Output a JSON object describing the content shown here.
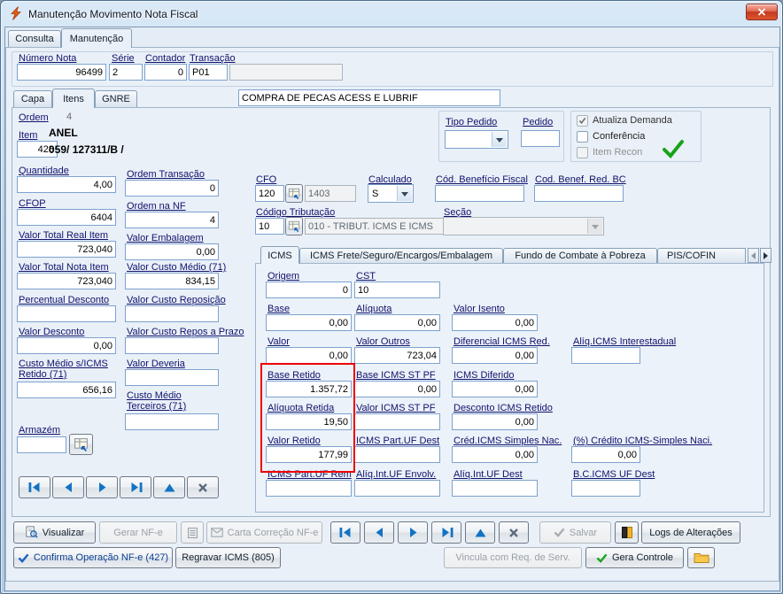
{
  "window": {
    "title": "Manutenção Movimento Nota Fiscal"
  },
  "main_tabs": {
    "consulta": "Consulta",
    "manutencao": "Manutenção"
  },
  "header": {
    "numero_label": "Número Nota",
    "numero": "96499",
    "serie_label": "Série",
    "serie": "2",
    "contador_label": "Contador",
    "contador": "0",
    "transacao_label": "Transação",
    "transacao": "P01",
    "transacao_extra": ""
  },
  "page_tabs": {
    "capa": "Capa",
    "itens": "Itens",
    "gnre": "GNRE"
  },
  "descricao": "COMPRA DE PECAS ACESS E LUBRIF",
  "item": {
    "ordem_label": "Ordem",
    "ordem": "4",
    "item_label": "Item",
    "codigo": "428",
    "nome": "ANEL",
    "referencia": "059/ 127311/B /",
    "tipo_pedido_label": "Tipo Pedido",
    "tipo_pedido": "",
    "pedido_label": "Pedido",
    "pedido": "",
    "atualiza_demanda_label": "Atualiza Demanda",
    "conferencia_label": "Conferência",
    "item_recon_label": "Item Recon"
  },
  "col1": [
    {
      "label": "Quantidade",
      "value": "4,00"
    },
    {
      "label": "CFOP",
      "value": "6404"
    },
    {
      "label": "Valor Total Real Item",
      "value": "723,040"
    },
    {
      "label": "Valor Total Nota Item",
      "value": "723,040"
    },
    {
      "label": "Percentual Desconto",
      "value": ""
    },
    {
      "label": "Valor Desconto",
      "value": "0,00"
    },
    {
      "label_l1": "Custo Médio s/ICMS",
      "label_l2": "Retido (71)",
      "value": "656,16"
    }
  ],
  "armazem": {
    "label": "Armazém",
    "value": ""
  },
  "col2": [
    {
      "label": "Ordem Transação",
      "value": "0"
    },
    {
      "label": "Ordem na NF",
      "value": "4"
    },
    {
      "label": "Valor Embalagem",
      "value": "0,00"
    },
    {
      "label": "Valor Custo Médio (71)",
      "value": "834,15"
    },
    {
      "label": "Valor Custo Reposição",
      "value": ""
    },
    {
      "label": "Valor Custo Repos a Prazo",
      "value": ""
    },
    {
      "label": "Valor Deveria",
      "value": ""
    },
    {
      "label_l1": "Custo Médio",
      "label_l2": "Terceiros (71)",
      "value": ""
    }
  ],
  "fiscal": {
    "cfo_label": "CFO",
    "cfo": "120",
    "cfo_desc": "1403",
    "calculado_label": "Calculado",
    "calculado": "S",
    "benef_label": "Cód. Benefício Fiscal",
    "benef": "",
    "benef_red_label": "Cod. Benef. Red. BC",
    "benef_red": "",
    "trib_label": "Código Tributação",
    "trib": "10",
    "trib_desc": "010 - TRIBUT. ICMS E ICMS",
    "secao_label": "Seção",
    "secao": ""
  },
  "icms_tabs": {
    "t0": "ICMS",
    "t1": "ICMS Frete/Seguro/Encargos/Embalagem",
    "t2": "Fundo de Combate à Pobreza",
    "t3": "PIS/COFIN"
  },
  "icms": [
    {
      "label": "Origem",
      "value": "0"
    },
    {
      "label": "CST",
      "value": "10"
    },
    {
      "label": "Base",
      "value": "0,00"
    },
    {
      "label": "Alíquota",
      "value": "0,00"
    },
    {
      "label": "Valor Isento",
      "value": "0,00"
    },
    {
      "label": "Valor",
      "value": "0,00"
    },
    {
      "label": "Valor Outros",
      "value": "723,04"
    },
    {
      "label": "Diferencial ICMS Red.",
      "value": "0,00"
    },
    {
      "label": "Alíq.ICMS Interestadual",
      "value": ""
    },
    {
      "label": "Base Retido",
      "value": "1.357,72"
    },
    {
      "label": "Base ICMS ST PF",
      "value": "0,00"
    },
    {
      "label": "ICMS Diferido",
      "value": "0,00"
    },
    {
      "label": "Alíquota Retida",
      "value": "19,50"
    },
    {
      "label": "Valor ICMS ST PF",
      "value": ""
    },
    {
      "label": "Desconto ICMS Retido",
      "value": "0,00"
    },
    {
      "label": "Valor Retido",
      "value": "177,99"
    },
    {
      "label": "ICMS Part.UF Dest",
      "value": ""
    },
    {
      "label": "Créd.ICMS Simples Nac.",
      "value": "0,00"
    },
    {
      "label": "(%) Crédito ICMS-Simples Naci.",
      "value": "0,00"
    },
    {
      "label": "ICMS Part.UF Rem",
      "value": ""
    },
    {
      "label": "Alíq.Int.UF Envolv.",
      "value": ""
    },
    {
      "label": "Alíq.Int.UF Dest",
      "value": ""
    },
    {
      "label": "B.C.ICMS UF Dest",
      "value": ""
    }
  ],
  "toolbar": {
    "visualizar": "Visualizar",
    "gerar_nfe": "Gerar NF-e",
    "carta_correcao": "Carta Correção NF-e",
    "salvar": "Salvar",
    "logs": "Logs de Alterações"
  },
  "actions": {
    "confirma": "Confirma Operação NF-e (427)",
    "regravar": "Regravar ICMS (805)",
    "vincula": "Vincula com Req. de Serv.",
    "gera_controle": "Gera Controle"
  }
}
